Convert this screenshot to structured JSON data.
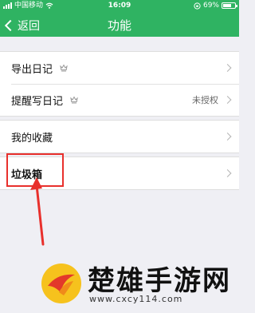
{
  "status_bar": {
    "carrier": "中国移动",
    "time": "16:09",
    "battery_percent": "69%",
    "battery_level": 0.69
  },
  "nav": {
    "back_label": "返回",
    "title": "功能"
  },
  "groups": [
    {
      "items": [
        {
          "label": "导出日记",
          "icon": "crown-badge-icon",
          "value": ""
        },
        {
          "label": "提醒写日记",
          "icon": "crown-badge-icon",
          "value": "未授权"
        }
      ]
    },
    {
      "items": [
        {
          "label": "我的收藏",
          "value": ""
        }
      ]
    },
    {
      "items": [
        {
          "label": "垃圾箱",
          "value": ""
        }
      ]
    }
  ],
  "watermark": {
    "brand": "楚雄手游网",
    "url": "www.cxcy114.com"
  },
  "colors": {
    "header": "#2fb362",
    "annotation": "#e8302c"
  }
}
